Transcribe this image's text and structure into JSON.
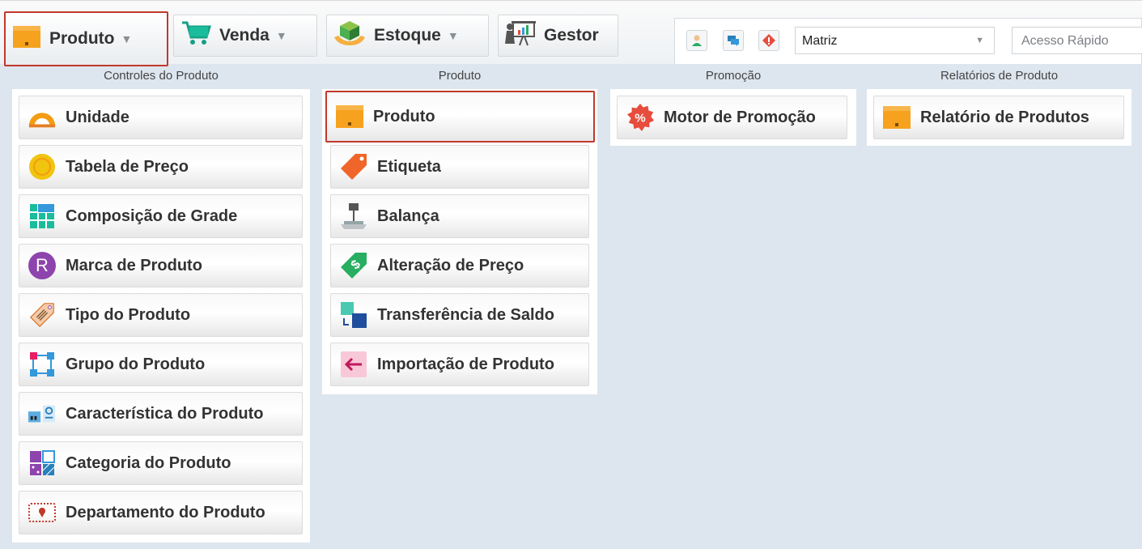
{
  "topbar": {
    "menus": [
      {
        "label": "Produto",
        "icon": "box-icon"
      },
      {
        "label": "Venda",
        "icon": "cart-icon"
      },
      {
        "label": "Estoque",
        "icon": "stock-icon"
      },
      {
        "label": "Gestor",
        "icon": "presentation-icon"
      }
    ],
    "caret": "▼",
    "branch_select": {
      "value": "Matriz",
      "arrow": "▼"
    },
    "quick_access": {
      "placeholder": "Acesso Rápido"
    }
  },
  "sections": {
    "controles": {
      "title": "Controles do Produto",
      "items": [
        {
          "label": "Unidade"
        },
        {
          "label": "Tabela de Preço"
        },
        {
          "label": "Composição de Grade"
        },
        {
          "label": "Marca de Produto",
          "glyph": "R"
        },
        {
          "label": "Tipo do Produto"
        },
        {
          "label": "Grupo do Produto"
        },
        {
          "label": "Característica do Produto"
        },
        {
          "label": "Categoria do Produto"
        },
        {
          "label": "Departamento do Produto"
        }
      ]
    },
    "produto": {
      "title": "Produto",
      "items": [
        {
          "label": "Produto"
        },
        {
          "label": "Etiqueta"
        },
        {
          "label": "Balança"
        },
        {
          "label": "Alteração de Preço",
          "glyph": "$"
        },
        {
          "label": "Transferência de Saldo"
        },
        {
          "label": "Importação de Produto"
        }
      ]
    },
    "promocao": {
      "title": "Promoção",
      "items": [
        {
          "label": "Motor de Promoção",
          "glyph": "%"
        }
      ]
    },
    "relatorios": {
      "title": "Relatórios de Produto",
      "items": [
        {
          "label": "Relatório de Produtos"
        }
      ]
    }
  },
  "colors": {
    "active_border": "#c0392b",
    "background": "#dde6ef",
    "orange": "#f39c12"
  }
}
